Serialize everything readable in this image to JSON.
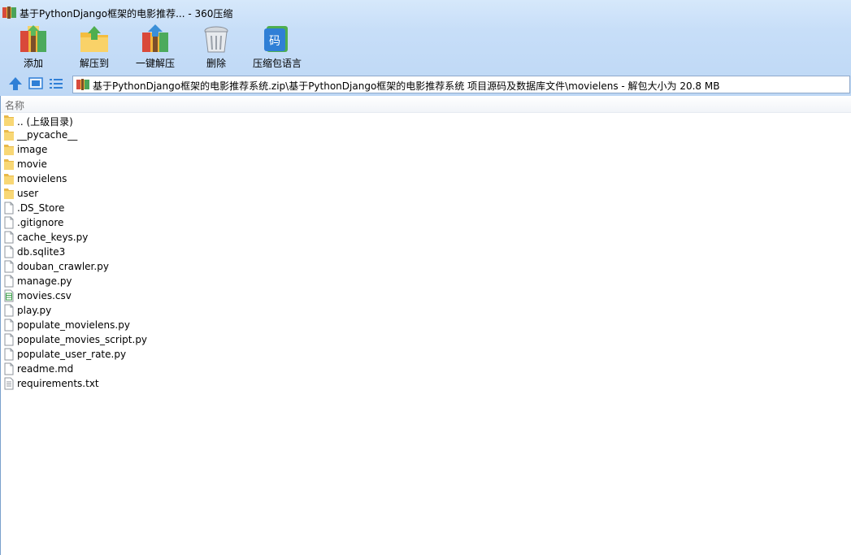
{
  "window": {
    "title": "基于PythonDjango框架的电影推荐... - 360压缩"
  },
  "toolbar": {
    "add_label": "添加",
    "extract_label": "解压到",
    "oneclick_label": "一键解压",
    "delete_label": "删除",
    "lang_label": "压缩包语言",
    "lang_icon_text": "码"
  },
  "address": {
    "path": "基于PythonDjango框架的电影推荐系统.zip\\基于PythonDjango框架的电影推荐系统 项目源码及数据库文件\\movielens - 解包大小为 20.8 MB"
  },
  "list": {
    "column_name": "名称",
    "files": [
      {
        "name": ".. (上级目录)",
        "icon": "folder"
      },
      {
        "name": "__pycache__",
        "icon": "folder"
      },
      {
        "name": "image",
        "icon": "folder"
      },
      {
        "name": "movie",
        "icon": "folder"
      },
      {
        "name": "movielens",
        "icon": "folder"
      },
      {
        "name": "user",
        "icon": "folder"
      },
      {
        "name": ".DS_Store",
        "icon": "file"
      },
      {
        "name": ".gitignore",
        "icon": "file"
      },
      {
        "name": "cache_keys.py",
        "icon": "file"
      },
      {
        "name": "db.sqlite3",
        "icon": "file"
      },
      {
        "name": "douban_crawler.py",
        "icon": "file"
      },
      {
        "name": "manage.py",
        "icon": "file"
      },
      {
        "name": "movies.csv",
        "icon": "csv"
      },
      {
        "name": "play.py",
        "icon": "file"
      },
      {
        "name": "populate_movielens.py",
        "icon": "file"
      },
      {
        "name": "populate_movies_script.py",
        "icon": "file"
      },
      {
        "name": "populate_user_rate.py",
        "icon": "file"
      },
      {
        "name": "readme.md",
        "icon": "file"
      },
      {
        "name": "requirements.txt",
        "icon": "text"
      }
    ]
  },
  "colors": {
    "chrome_top": "#d6e8fb",
    "chrome_bottom": "#bdd7f5",
    "folder": "#f8d775",
    "accent": "#2f7fd6"
  }
}
